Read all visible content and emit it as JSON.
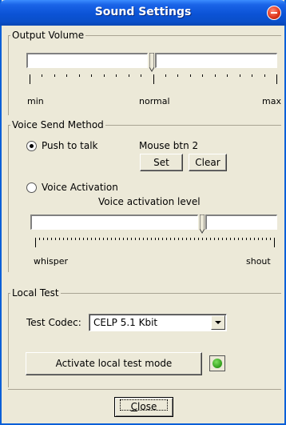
{
  "window": {
    "title": "Sound Settings"
  },
  "output_volume": {
    "label": "Output Volume",
    "min_label": "min",
    "normal_label": "normal",
    "max_label": "max",
    "level": 0.5
  },
  "voice_send": {
    "label": "Voice Send Method",
    "push_to_talk_label": "Push to talk",
    "push_to_talk_selected": true,
    "hotkey_value": "Mouse btn 2",
    "set_label": "Set",
    "clear_label": "Clear",
    "voice_activation_label": "Voice Activation",
    "voice_activation_selected": false,
    "activation_level_label": "Voice activation level",
    "whisper_label": "whisper",
    "shout_label": "shout",
    "activation_level": 0.72
  },
  "local_test": {
    "label": "Local Test",
    "codec_label": "Test Codec:",
    "codec_value": "CELP 5.1 Kbit",
    "activate_label": "Activate local test mode",
    "status_color": "#2f9c1a"
  },
  "footer": {
    "close_label": "Close"
  }
}
